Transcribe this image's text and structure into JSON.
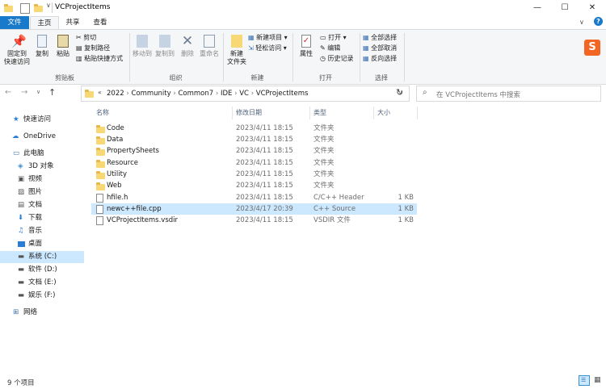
{
  "window": {
    "title": "VCProjectItems"
  },
  "ribbon_tabs": [
    "文件",
    "主页",
    "共享",
    "查看"
  ],
  "clipboard": {
    "pin_label_1": "固定到",
    "pin_label_2": "快速访问",
    "copy": "复制",
    "paste": "粘贴",
    "cut": "剪切",
    "copy_path": "复制路径",
    "paste_shortcut": "粘贴快捷方式",
    "group": "剪贴板"
  },
  "organize": {
    "move_to": "移动到",
    "copy_to": "复制到",
    "delete": "删除",
    "rename": "重命名",
    "group": "组织"
  },
  "new": {
    "new_folder_1": "新建",
    "new_folder_2": "文件夹",
    "new_item": "新建项目",
    "easy_access": "轻松访问",
    "group": "新建"
  },
  "open": {
    "properties": "属性",
    "open": "打开",
    "edit": "编辑",
    "history": "历史记录",
    "group": "打开"
  },
  "select": {
    "select_all": "全部选择",
    "select_none": "全部取消",
    "invert": "反向选择",
    "group": "选择"
  },
  "address": {
    "crumbs": [
      "2022",
      "Community",
      "Common7",
      "IDE",
      "VC",
      "VCProjectItems"
    ]
  },
  "search": {
    "placeholder": "在 VCProjectItems 中搜索"
  },
  "nav_items": [
    {
      "label": "快速访问",
      "icon": "star-icon"
    },
    {
      "label": "OneDrive",
      "icon": "cloud-icon"
    },
    {
      "label": "此电脑",
      "icon": "computer-icon"
    },
    {
      "label": "3D 对象",
      "icon": "cube-icon"
    },
    {
      "label": "视频",
      "icon": "video-icon"
    },
    {
      "label": "图片",
      "icon": "picture-icon"
    },
    {
      "label": "文档",
      "icon": "document-icon"
    },
    {
      "label": "下载",
      "icon": "download-icon"
    },
    {
      "label": "音乐",
      "icon": "music-icon"
    },
    {
      "label": "桌面",
      "icon": "desktop-icon"
    },
    {
      "label": "系统 (C:)",
      "icon": "drive-icon"
    },
    {
      "label": "软件 (D:)",
      "icon": "drive-icon"
    },
    {
      "label": "文档 (E:)",
      "icon": "drive-icon"
    },
    {
      "label": "娱乐 (F:)",
      "icon": "drive-icon"
    },
    {
      "label": "网络",
      "icon": "network-icon"
    }
  ],
  "columns": [
    "名称",
    "修改日期",
    "类型",
    "大小"
  ],
  "files": [
    {
      "name": "Code",
      "date": "2023/4/11 18:15",
      "type": "文件夹",
      "size": "",
      "kind": "folder"
    },
    {
      "name": "Data",
      "date": "2023/4/11 18:15",
      "type": "文件夹",
      "size": "",
      "kind": "folder"
    },
    {
      "name": "PropertySheets",
      "date": "2023/4/11 18:15",
      "type": "文件夹",
      "size": "",
      "kind": "folder"
    },
    {
      "name": "Resource",
      "date": "2023/4/11 18:15",
      "type": "文件夹",
      "size": "",
      "kind": "folder"
    },
    {
      "name": "Utility",
      "date": "2023/4/11 18:15",
      "type": "文件夹",
      "size": "",
      "kind": "folder"
    },
    {
      "name": "Web",
      "date": "2023/4/11 18:15",
      "type": "文件夹",
      "size": "",
      "kind": "folder"
    },
    {
      "name": "hfile.h",
      "date": "2023/4/11 18:15",
      "type": "C/C++ Header",
      "size": "1 KB",
      "kind": "file"
    },
    {
      "name": "newc++file.cpp",
      "date": "2023/4/17 20:39",
      "type": "C++ Source",
      "size": "1 KB",
      "kind": "file"
    },
    {
      "name": "VCProjectItems.vsdir",
      "date": "2023/4/11 18:15",
      "type": "VSDIR 文件",
      "size": "1 KB",
      "kind": "file"
    }
  ],
  "status": {
    "count": "9 个项目"
  },
  "colors": {
    "accent": "#1979ca",
    "selection": "#cce8ff",
    "folder": "#f8d775"
  }
}
